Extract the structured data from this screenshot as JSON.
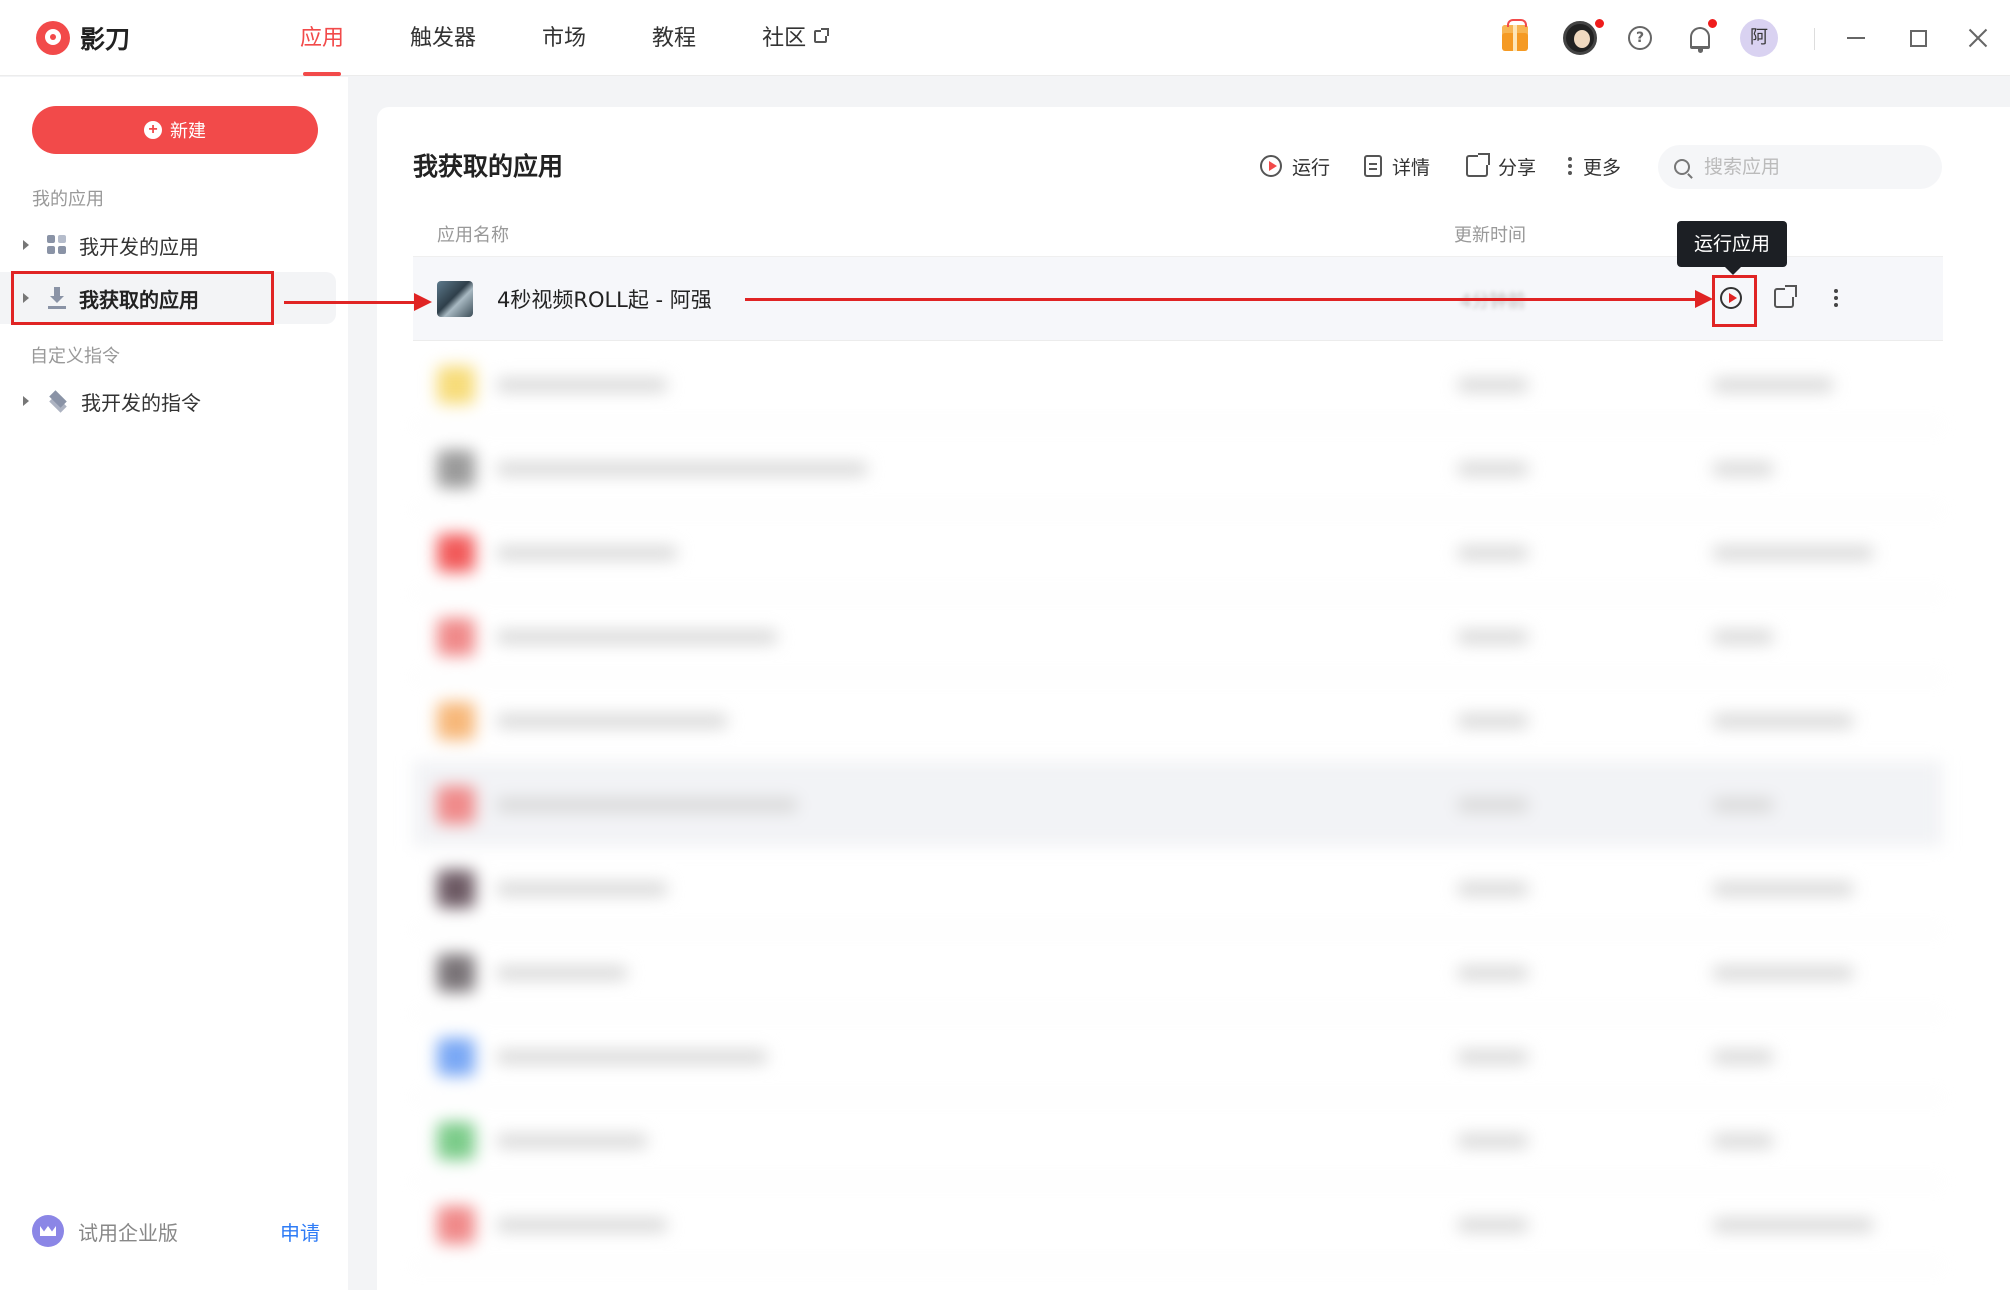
{
  "app": {
    "name": "影刀"
  },
  "nav": {
    "tabs": [
      {
        "label": "应用",
        "active": true
      },
      {
        "label": "触发器"
      },
      {
        "label": "市场"
      },
      {
        "label": "教程"
      },
      {
        "label": "社区",
        "external": true
      }
    ]
  },
  "header_icons": [
    "gift-icon",
    "avatar-face-icon",
    "help-icon",
    "bell-icon"
  ],
  "user": {
    "avatar_text": "阿"
  },
  "sidebar": {
    "new_button": "新建",
    "sections": [
      {
        "label": "我的应用",
        "items": [
          {
            "label": "我开发的应用",
            "icon": "grid-icon"
          },
          {
            "label": "我获取的应用",
            "icon": "download-icon",
            "selected": true
          }
        ]
      },
      {
        "label": "自定义指令",
        "items": [
          {
            "label": "我开发的指令",
            "icon": "layers-icon"
          }
        ]
      }
    ],
    "enterprise": {
      "text": "试用企业版",
      "link": "申请"
    }
  },
  "main": {
    "title": "我获取的应用",
    "toolbar": {
      "run": "运行",
      "details": "详情",
      "share": "分享",
      "more": "更多"
    },
    "search": {
      "placeholder": "搜索应用"
    },
    "columns": {
      "name": "应用名称",
      "updated": "更新时间"
    },
    "rows": [
      {
        "name": "4秒视频ROLL起 - 阿强",
        "updated": "4分钟前"
      }
    ],
    "tooltip": "运行应用"
  },
  "colors": {
    "accent": "#f24a4a",
    "annotation": "#e02424",
    "link": "#2f7cf6"
  }
}
